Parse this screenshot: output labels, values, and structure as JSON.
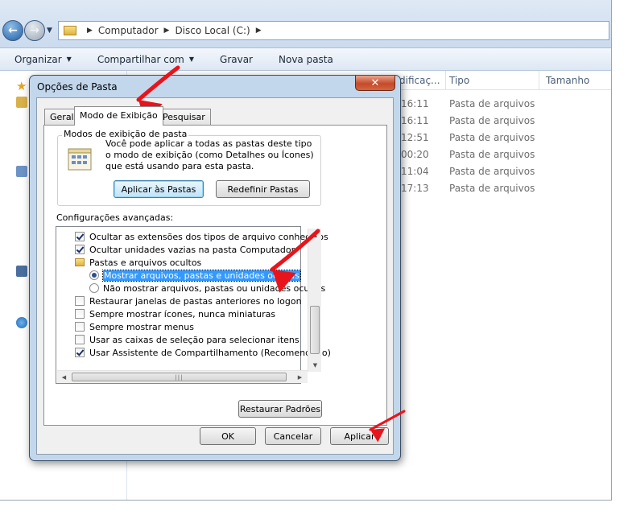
{
  "explorer": {
    "breadcrumb": [
      "Computador",
      "Disco Local (C:)"
    ],
    "toolbar": [
      {
        "label": "Organizar",
        "caret": true
      },
      {
        "label": "Compartilhar com",
        "caret": true
      },
      {
        "label": "Gravar",
        "caret": false
      },
      {
        "label": "Nova pasta",
        "caret": false
      }
    ],
    "columns": {
      "modified": "dificaç...",
      "type": "Tipo",
      "size": "Tamanho"
    },
    "rows": [
      {
        "time": "16:11",
        "type": "Pasta de arquivos"
      },
      {
        "time": "16:11",
        "type": "Pasta de arquivos"
      },
      {
        "time": "12:51",
        "type": "Pasta de arquivos"
      },
      {
        "time": "00:20",
        "type": "Pasta de arquivos"
      },
      {
        "time": "11:04",
        "type": "Pasta de arquivos"
      },
      {
        "time": "17:13",
        "type": "Pasta de arquivos"
      }
    ]
  },
  "dialog": {
    "title": "Opções de Pasta",
    "close_glyph": "✕",
    "tabs": [
      "Geral",
      "Modo de Exibição",
      "Pesquisar"
    ],
    "folder_views": {
      "label": "Modos de exibição de pasta",
      "description": "Você pode aplicar a todas as pastas deste tipo o modo de exibição (como Detalhes ou Ícones) que está usando para esta pasta.",
      "apply_button": "Aplicar às Pastas",
      "reset_button": "Redefinir Pastas"
    },
    "advanced_label": "Configurações avançadas:",
    "settings": [
      {
        "kind": "checkbox",
        "checked": true,
        "label": "Ocultar as extensões dos tipos de arquivo conhecidos"
      },
      {
        "kind": "checkbox",
        "checked": true,
        "label": "Ocultar unidades vazias na pasta Computador"
      },
      {
        "kind": "folder",
        "label": "Pastas e arquivos ocultos"
      },
      {
        "kind": "radio",
        "checked": true,
        "selected": true,
        "label": "Mostrar arquivos, pastas e unidades ocultas"
      },
      {
        "kind": "radio",
        "checked": false,
        "label": "Não mostrar arquivos, pastas ou unidades ocultas"
      },
      {
        "kind": "checkbox",
        "checked": false,
        "label": "Restaurar janelas de pastas anteriores no logon"
      },
      {
        "kind": "checkbox",
        "checked": false,
        "label": "Sempre mostrar ícones, nunca miniaturas"
      },
      {
        "kind": "checkbox",
        "checked": false,
        "label": "Sempre mostrar menus"
      },
      {
        "kind": "checkbox",
        "checked": false,
        "label": "Usar as caixas de seleção para selecionar itens"
      },
      {
        "kind": "checkbox",
        "checked": true,
        "label": "Usar Assistente de Compartilhamento (Recomendado)"
      }
    ],
    "restore_button": "Restaurar Padrões",
    "ok_button": "OK",
    "cancel_button": "Cancelar",
    "apply_button": "Aplicar"
  },
  "colors": {
    "annotation_arrow": "#e8141b",
    "selection": "#3399ff"
  }
}
